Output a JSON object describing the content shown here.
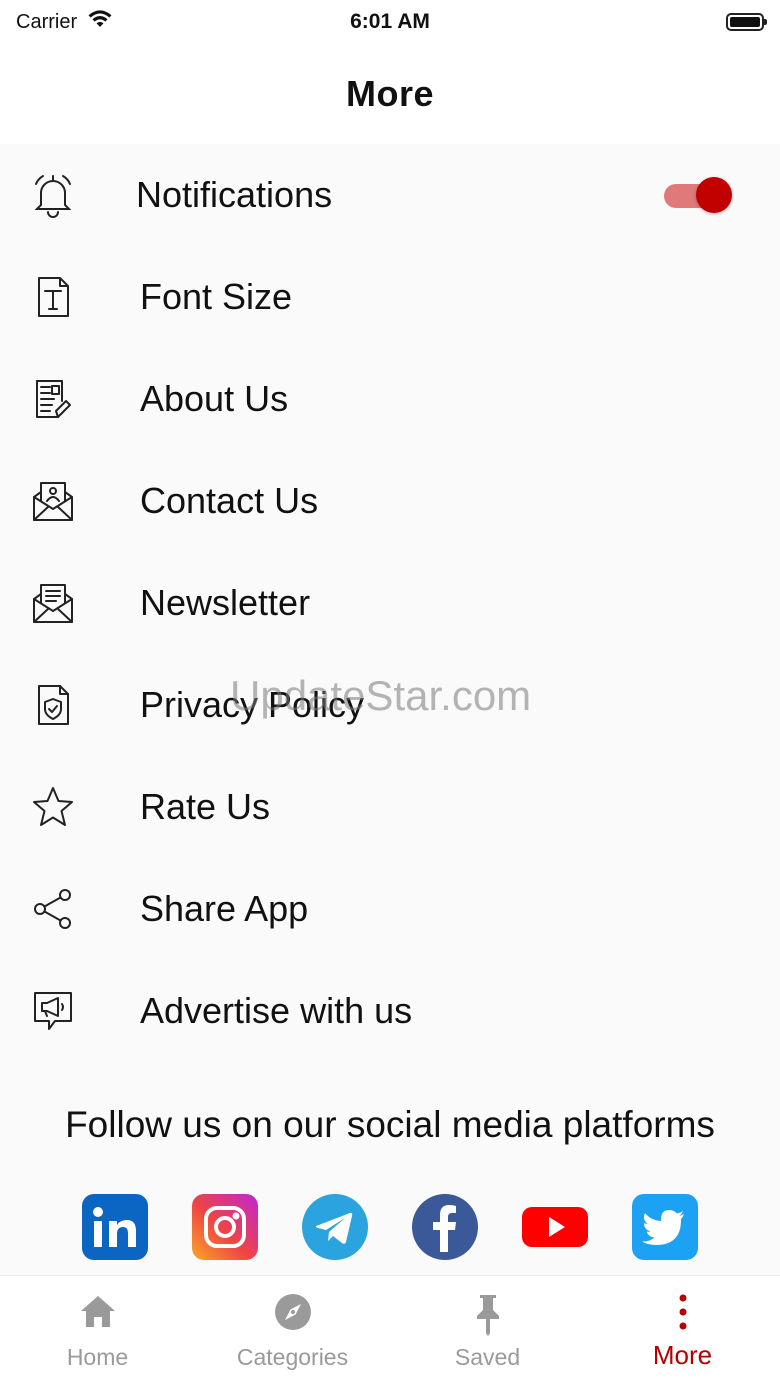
{
  "status_bar": {
    "carrier": "Carrier",
    "time": "6:01 AM"
  },
  "header": {
    "title": "More"
  },
  "menu": {
    "items": [
      {
        "label": "Notifications",
        "icon": "bell-icon"
      },
      {
        "label": "Font Size",
        "icon": "font-size-icon"
      },
      {
        "label": "About Us",
        "icon": "about-icon"
      },
      {
        "label": "Contact Us",
        "icon": "contact-icon"
      },
      {
        "label": "Newsletter",
        "icon": "newsletter-icon"
      },
      {
        "label": "Privacy Policy",
        "icon": "shield-icon"
      },
      {
        "label": "Rate Us",
        "icon": "star-icon"
      },
      {
        "label": "Share App",
        "icon": "share-icon"
      },
      {
        "label": "Advertise with us",
        "icon": "megaphone-icon"
      }
    ],
    "notifications_enabled": true
  },
  "social": {
    "title": "Follow us on our social media platforms",
    "platforms": [
      "linkedin-icon",
      "instagram-icon",
      "telegram-icon",
      "facebook-icon",
      "youtube-icon",
      "twitter-icon"
    ]
  },
  "watermark": "UpdateStar.com",
  "tabbar": {
    "tabs": [
      {
        "label": "Home",
        "icon": "home-icon"
      },
      {
        "label": "Categories",
        "icon": "compass-icon"
      },
      {
        "label": "Saved",
        "icon": "pin-icon"
      },
      {
        "label": "More",
        "icon": "more-icon"
      }
    ],
    "active": "More"
  },
  "colors": {
    "accent": "#b40000",
    "toggle_track": "#e07a7a",
    "inactive_tab": "#9a9a9a"
  }
}
